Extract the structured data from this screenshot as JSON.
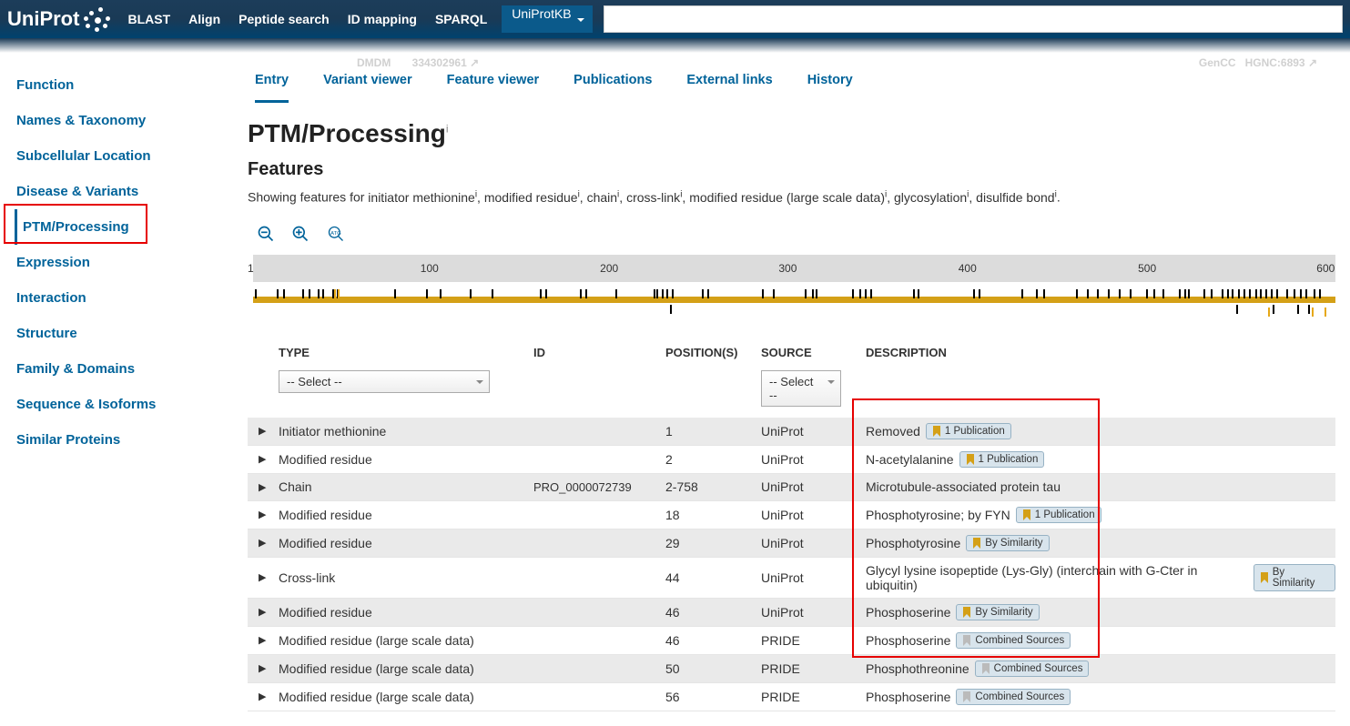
{
  "topnav": {
    "brand": "UniProt",
    "links": [
      "BLAST",
      "Align",
      "Peptide search",
      "ID mapping",
      "SPARQL"
    ],
    "search_cat": "UniProtKB"
  },
  "faded": {
    "left1": "DMDM",
    "left2": "334302961",
    "right1": "GenCC",
    "right2": "HGNC:6893"
  },
  "sidebar": [
    "Function",
    "Names & Taxonomy",
    "Subcellular Location",
    "Disease & Variants",
    "PTM/Processing",
    "Expression",
    "Interaction",
    "Structure",
    "Family & Domains",
    "Sequence & Isoforms",
    "Similar Proteins"
  ],
  "subtabs": [
    "Entry",
    "Variant viewer",
    "Feature viewer",
    "Publications",
    "External links",
    "History"
  ],
  "page": {
    "title": "PTM/Processing",
    "features_heading": "Features",
    "showing_prefix": "Showing features for ",
    "showing_items": [
      "initiator methionine",
      "modified residue",
      "chain",
      "cross-link",
      "modified residue (large scale data)",
      "glycosylation",
      "disulfide bond"
    ]
  },
  "ruler": {
    "ticks": [
      "100",
      "200",
      "300",
      "400",
      "500",
      "600"
    ]
  },
  "columns": {
    "type": "TYPE",
    "id": "ID",
    "positions": "POSITION(S)",
    "source": "SOURCE",
    "description": "DESCRIPTION"
  },
  "selects": {
    "placeholder": "-- Select --"
  },
  "badges": {
    "pub1": "1 Publication",
    "bysim": "By Similarity",
    "combined": "Combined Sources"
  },
  "rows": [
    {
      "type": "Initiator methionine",
      "id": "",
      "pos": "1",
      "src": "UniProt",
      "desc": "Removed",
      "badge": "pub1",
      "ribbon": "gold",
      "stripe": true
    },
    {
      "type": "Modified residue",
      "id": "",
      "pos": "2",
      "src": "UniProt",
      "desc": "N-acetylalanine",
      "badge": "pub1",
      "ribbon": "gold",
      "stripe": false
    },
    {
      "type": "Chain",
      "id": "PRO_0000072739",
      "pos": "2-758",
      "src": "UniProt",
      "desc": "Microtubule-associated protein tau",
      "badge": "",
      "ribbon": "",
      "stripe": true
    },
    {
      "type": "Modified residue",
      "id": "",
      "pos": "18",
      "src": "UniProt",
      "desc": "Phosphotyrosine; by FYN",
      "badge": "pub1",
      "ribbon": "gold",
      "stripe": false
    },
    {
      "type": "Modified residue",
      "id": "",
      "pos": "29",
      "src": "UniProt",
      "desc": "Phosphotyrosine",
      "badge": "bysim",
      "ribbon": "gold",
      "stripe": true
    },
    {
      "type": "Cross-link",
      "id": "",
      "pos": "44",
      "src": "UniProt",
      "desc": "Glycyl lysine isopeptide (Lys-Gly) (interchain with G-Cter in ubiquitin)",
      "badge": "bysim",
      "ribbon": "gold",
      "stripe": false
    },
    {
      "type": "Modified residue",
      "id": "",
      "pos": "46",
      "src": "UniProt",
      "desc": "Phosphoserine",
      "badge": "bysim",
      "ribbon": "gold",
      "stripe": true
    },
    {
      "type": "Modified residue (large scale data)",
      "id": "",
      "pos": "46",
      "src": "PRIDE",
      "desc": "Phosphoserine",
      "badge": "combined",
      "ribbon": "gray",
      "stripe": false
    },
    {
      "type": "Modified residue (large scale data)",
      "id": "",
      "pos": "50",
      "src": "PRIDE",
      "desc": "Phosphothreonine",
      "badge": "combined",
      "ribbon": "gray",
      "stripe": true
    },
    {
      "type": "Modified residue (large scale data)",
      "id": "",
      "pos": "56",
      "src": "PRIDE",
      "desc": "Phosphoserine",
      "badge": "combined",
      "ribbon": "gray",
      "stripe": false
    }
  ]
}
